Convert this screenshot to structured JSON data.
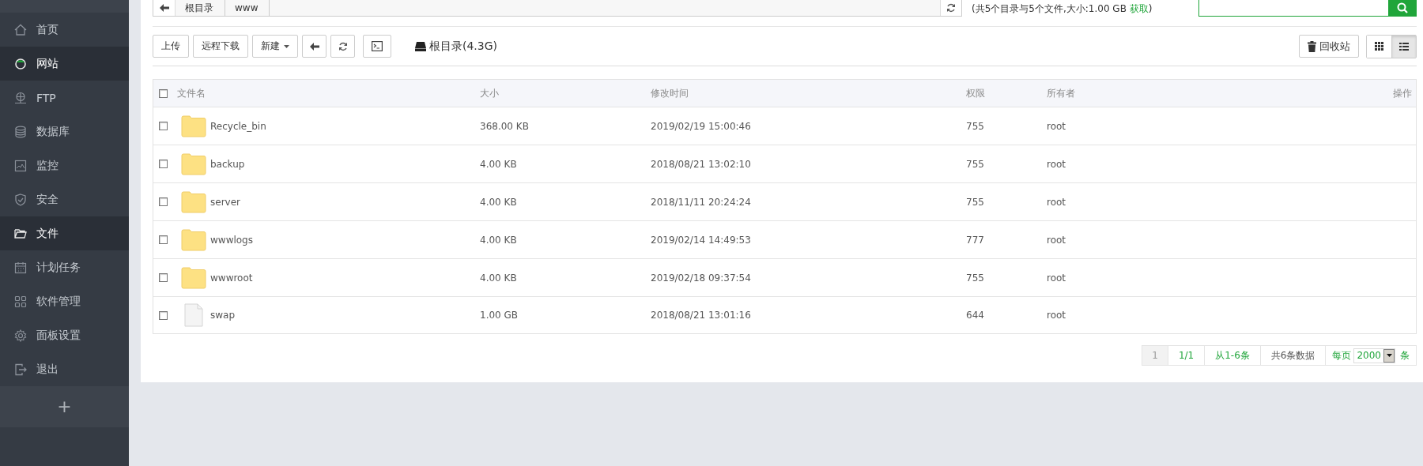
{
  "sidebar": {
    "items": [
      {
        "label": "首页",
        "selected": false
      },
      {
        "label": "网站",
        "selected": true
      },
      {
        "label": "FTP",
        "selected": false
      },
      {
        "label": "数据库",
        "selected": false
      },
      {
        "label": "监控",
        "selected": false
      },
      {
        "label": "安全",
        "selected": false
      },
      {
        "label": "文件",
        "selected": true
      },
      {
        "label": "计划任务",
        "selected": false
      },
      {
        "label": "软件管理",
        "selected": false
      },
      {
        "label": "面板设置",
        "selected": false
      },
      {
        "label": "退出",
        "selected": false
      }
    ],
    "add_button": "+"
  },
  "path_bar": {
    "segments": [
      "根目录",
      "www"
    ],
    "info": {
      "prefix": "(共5个目录与5个文件,大小:1.00 GB",
      "link": "获取",
      "suffix": ")"
    }
  },
  "toolbar": {
    "buttons": [
      {
        "kind": "text",
        "label": "上传"
      },
      {
        "kind": "text",
        "label": "远程下载"
      },
      {
        "kind": "dropdown",
        "label": "新建"
      },
      {
        "kind": "back"
      },
      {
        "kind": "refresh"
      },
      {
        "kind": "terminal"
      }
    ],
    "disk": "根目录(4.3G)",
    "recycle_button": "回收站",
    "views": [
      {
        "kind": "grid",
        "selected": false
      },
      {
        "kind": "list",
        "selected": true
      }
    ]
  },
  "table": {
    "header_checkbox": {
      "checked": false
    },
    "columns": [
      "文件名",
      "大小",
      "修改时间",
      "权限",
      "所有者",
      "操作"
    ],
    "rows": [
      {
        "checked": false,
        "kind": "folder",
        "name": "Recycle_bin",
        "size": "368.00 KB",
        "modified": "2019/02/19 15:00:46",
        "permission": "755",
        "owner": "root"
      },
      {
        "checked": false,
        "kind": "folder",
        "name": "backup",
        "size": "4.00 KB",
        "modified": "2018/08/21 13:02:10",
        "permission": "755",
        "owner": "root"
      },
      {
        "checked": false,
        "kind": "folder",
        "name": "server",
        "size": "4.00 KB",
        "modified": "2018/11/11 20:24:24",
        "permission": "755",
        "owner": "root"
      },
      {
        "checked": false,
        "kind": "folder",
        "name": "wwwlogs",
        "size": "4.00 KB",
        "modified": "2019/02/14 14:49:53",
        "permission": "777",
        "owner": "root"
      },
      {
        "checked": false,
        "kind": "folder",
        "name": "wwwroot",
        "size": "4.00 KB",
        "modified": "2019/02/18 09:37:54",
        "permission": "755",
        "owner": "root"
      },
      {
        "checked": false,
        "kind": "file",
        "name": "swap",
        "size": "1.00 GB",
        "modified": "2018/08/21 13:01:16",
        "permission": "644",
        "owner": "root"
      }
    ]
  },
  "pagination": {
    "items": [
      {
        "kind": "current",
        "text": "1"
      },
      {
        "kind": "link",
        "text": "1/1"
      },
      {
        "kind": "link",
        "text": "从1-6条"
      },
      {
        "kind": "plain",
        "text": "共6条数据"
      }
    ],
    "per_page_label": "每页",
    "per_page_value": "2000",
    "per_page_suffix": "条"
  }
}
